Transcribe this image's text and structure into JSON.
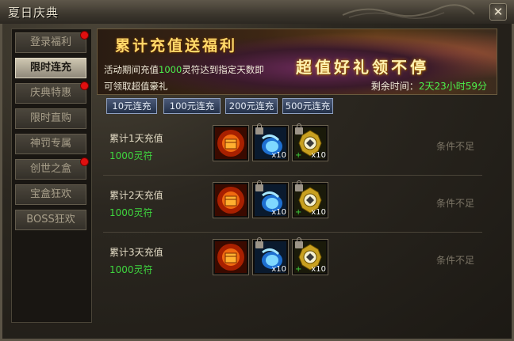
{
  "window": {
    "title": "夏日庆典",
    "close_label": "✕"
  },
  "sidebar": {
    "items": [
      {
        "label": "登录福利",
        "active": false,
        "badge": true
      },
      {
        "label": "限时连充",
        "active": true,
        "badge": false
      },
      {
        "label": "庆典特惠",
        "active": false,
        "badge": true
      },
      {
        "label": "限时直购",
        "active": false,
        "badge": false
      },
      {
        "label": "神罚专属",
        "active": false,
        "badge": false
      },
      {
        "label": "创世之盒",
        "active": false,
        "badge": true
      },
      {
        "label": "宝盒狂欢",
        "active": false,
        "badge": false
      },
      {
        "label": "BOSS狂欢",
        "active": false,
        "badge": false
      }
    ]
  },
  "banner": {
    "title": "累计充值送福利",
    "slogan": "超值好礼领不停",
    "desc_prefix": "活动期间充值",
    "desc_amount": "1000",
    "desc_suffix": "灵符达到指定天数即",
    "desc_line2": "可领取超值豪礼",
    "countdown_label": "剩余时间：",
    "countdown_value": "2天23小时59分"
  },
  "tabs": [
    "10元连充",
    "100元连充",
    "200元连充",
    "500元连充"
  ],
  "rows": [
    {
      "title": "累计1天充值",
      "amount": "1000灵符",
      "status": "条件不足",
      "rewards": [
        {
          "qty": ""
        },
        {
          "qty": "x10"
        },
        {
          "qty": "x10"
        }
      ]
    },
    {
      "title": "累计2天充值",
      "amount": "1000灵符",
      "status": "条件不足",
      "rewards": [
        {
          "qty": ""
        },
        {
          "qty": "x10"
        },
        {
          "qty": "x10"
        }
      ]
    },
    {
      "title": "累计3天充值",
      "amount": "1000灵符",
      "status": "条件不足",
      "rewards": [
        {
          "qty": ""
        },
        {
          "qty": "x10"
        },
        {
          "qty": "x10"
        }
      ]
    }
  ]
}
